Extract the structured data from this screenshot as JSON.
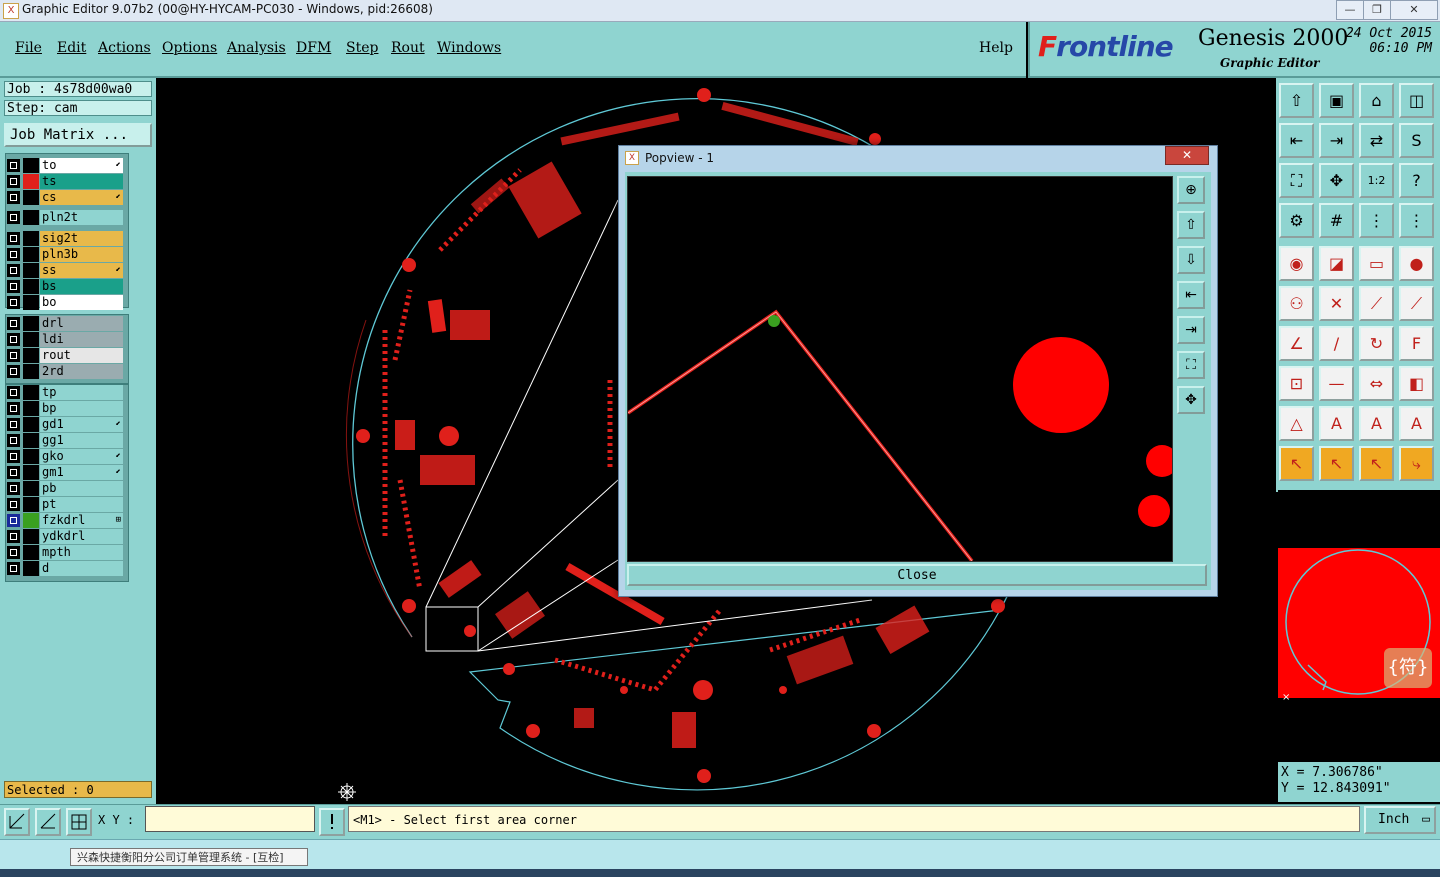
{
  "window": {
    "title": "Graphic Editor 9.07b2 (00@HY-HYCAM-PC030 - Windows, pid:26608)",
    "icon_char": "X",
    "minimize": "—",
    "maximize": "❐",
    "close": "✕"
  },
  "menu": [
    "File",
    "Edit",
    "Actions",
    "Options",
    "Analysis",
    "DFM",
    "Step",
    "Rout",
    "Windows"
  ],
  "help": "Help",
  "brand": {
    "logo_prefix": "F",
    "logo_rest": "rontline",
    "product": "Genesis 2000",
    "subtitle": "Graphic Editor",
    "date": "24 Oct 2015",
    "time": "06:10 PM"
  },
  "job": {
    "label": "Job : 4s78d00wa0",
    "step": "Step: cam",
    "matrix": "Job Matrix ..."
  },
  "layers": [
    {
      "name": "to",
      "bg": "#ffffff",
      "swatch": "#000000",
      "mark": "⬋"
    },
    {
      "name": "ts",
      "bg": "#1aa08a",
      "swatch": "#e0201b",
      "mark": ""
    },
    {
      "name": "cs",
      "bg": "#e8b94a",
      "swatch": "#000000",
      "mark": "⬋"
    },
    {
      "name": "pln2t",
      "bg": "#8fd4d0",
      "swatch": "#000000",
      "mark": ""
    },
    {
      "name": "sig2t",
      "bg": "#e8b94a",
      "swatch": "#000000",
      "mark": ""
    },
    {
      "name": "pln3b",
      "bg": "#e8b94a",
      "swatch": "#000000",
      "mark": ""
    },
    {
      "name": "ss",
      "bg": "#e8b94a",
      "swatch": "#000000",
      "mark": "⬋"
    },
    {
      "name": "bs",
      "bg": "#1aa08a",
      "swatch": "#000000",
      "mark": ""
    },
    {
      "name": "bo",
      "bg": "#ffffff",
      "swatch": "#000000",
      "mark": ""
    },
    {
      "name": "drl",
      "bg": "#9aacb0",
      "swatch": "#000000",
      "mark": ""
    },
    {
      "name": "ldi",
      "bg": "#9aacb0",
      "swatch": "#000000",
      "mark": ""
    },
    {
      "name": "rout",
      "bg": "#e6e6e6",
      "swatch": "#000000",
      "mark": ""
    },
    {
      "name": "2rd",
      "bg": "#9aacb0",
      "swatch": "#000000",
      "mark": ""
    },
    {
      "name": "tp",
      "bg": "#8fd4d0",
      "swatch": "#000000",
      "mark": ""
    },
    {
      "name": "bp",
      "bg": "#8fd4d0",
      "swatch": "#000000",
      "mark": ""
    },
    {
      "name": "gd1",
      "bg": "#8fd4d0",
      "swatch": "#000000",
      "mark": "⬋"
    },
    {
      "name": "gg1",
      "bg": "#8fd4d0",
      "swatch": "#000000",
      "mark": ""
    },
    {
      "name": "gko",
      "bg": "#8fd4d0",
      "swatch": "#000000",
      "mark": "⬋"
    },
    {
      "name": "gm1",
      "bg": "#8fd4d0",
      "swatch": "#000000",
      "mark": "⬋"
    },
    {
      "name": "pb",
      "bg": "#8fd4d0",
      "swatch": "#000000",
      "mark": ""
    },
    {
      "name": "pt",
      "bg": "#8fd4d0",
      "swatch": "#000000",
      "mark": ""
    },
    {
      "name": "fzkdrl",
      "bg": "#8fd4d0",
      "swatch": "#3aa020",
      "mark": "⊞"
    },
    {
      "name": "ydkdrl",
      "bg": "#8fd4d0",
      "swatch": "#000000",
      "mark": ""
    },
    {
      "name": "mpth",
      "bg": "#8fd4d0",
      "swatch": "#000000",
      "mark": ""
    },
    {
      "name": "d",
      "bg": "#8fd4d0",
      "swatch": "#000000",
      "mark": ""
    }
  ],
  "selected": "Selected : 0",
  "popview": {
    "title": "Popview - 1",
    "close_x": "✕",
    "close_button": "Close"
  },
  "xy_label": "X Y :",
  "xy_value": "",
  "prompt": "<M1> - Select first area corner",
  "unit": "Inch",
  "coords": {
    "x": "X = 7.306786\"",
    "y": "Y = 12.843091\""
  },
  "tooltip": "兴森快捷衡阳分公司订单管理系统 - [互检]",
  "minimap_badge": "{符}",
  "colors": {
    "panel": "#8fd4d0",
    "feature": "#e0201b",
    "highlight": "#3aa020"
  },
  "icons": {
    "right_toolbar": [
      "zoom-home-icon",
      "snapshot-icon",
      "home-view-icon",
      "window-icon",
      "pan-left-icon",
      "pan-right-icon",
      "flip-icon",
      "rotate-icon",
      "fit-icon",
      "zoom-fit-icon",
      "scale-1-2-icon",
      "help-icon",
      "measure-icon",
      "grid-icon",
      "layers-icon",
      "layers-alt-icon",
      "select-pad-icon",
      "select-line-icon",
      "ruler-icon",
      "circle-icon",
      "connect-icon",
      "cross-icon",
      "link-icon",
      "link-alt-icon",
      "angle-icon",
      "line-icon",
      "arc-icon",
      "text-icon",
      "move-icon",
      "minus-icon",
      "resize-icon",
      "shapes-icon",
      "triangle-icon",
      "triangle-a-icon",
      "triangle-b-icon",
      "triangle-c-icon",
      "pointer-icon",
      "pointer-select-icon",
      "pointer-circle-icon",
      "route-icon"
    ],
    "popview_tools": [
      "popview-zoom-icon",
      "popview-up-icon",
      "popview-down-icon",
      "popview-left-icon",
      "popview-right-icon",
      "popview-fit-icon",
      "popview-pan-icon"
    ]
  }
}
